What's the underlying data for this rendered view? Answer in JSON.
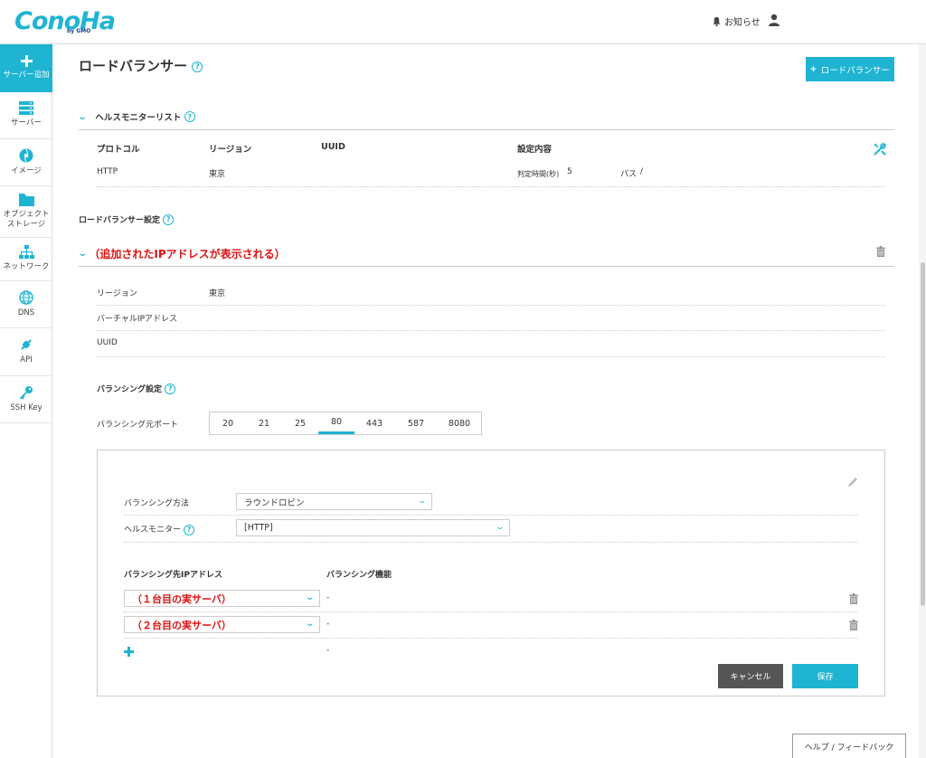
{
  "header": {
    "logo": "ConoHa",
    "logo_sub": "by GMO",
    "notice_label": "お知らせ"
  },
  "sidebar": {
    "items": [
      {
        "label": "サーバー追加",
        "icon": "plus-icon"
      },
      {
        "label": "サーバー",
        "icon": "server-icon"
      },
      {
        "label": "イメージ",
        "icon": "image-icon"
      },
      {
        "label": "オブジェクト\nストレージ",
        "icon": "folder-icon"
      },
      {
        "label": "ネットワーク",
        "icon": "network-icon"
      },
      {
        "label": "DNS",
        "icon": "globe-icon"
      },
      {
        "label": "API",
        "icon": "api-icon"
      },
      {
        "label": "SSH Key",
        "icon": "key-icon"
      }
    ]
  },
  "page": {
    "title": "ロードバランサー",
    "add_button": "ロードバランサー"
  },
  "health_monitor_list": {
    "title": "ヘルスモニターリスト",
    "columns": [
      "プロトコル",
      "リージョン",
      "UUID",
      "設定内容"
    ],
    "row": {
      "protocol": "HTTP",
      "region": "東京",
      "uuid": "",
      "judge_label": "判定時間(秒)",
      "judge_value": "5",
      "path_label": "パス",
      "path_value": "/"
    }
  },
  "lb_settings": {
    "title": "ロードバランサー設定",
    "ip_heading": "（追加されたIPアドレスが表示される）",
    "region_label": "リージョン",
    "region_value": "東京",
    "vip_label": "バーチャルIPアドレス",
    "uuid_label": "UUID"
  },
  "balancing": {
    "title": "バランシング設定",
    "port_label": "バランシング元ポート",
    "ports": [
      "20",
      "21",
      "25",
      "80",
      "443",
      "587",
      "8080"
    ],
    "active_port": "80",
    "method_label": "バランシング方法",
    "method_value": "ラウンドロビン",
    "monitor_label": "ヘルスモニター",
    "monitor_value": "[HTTP]",
    "dest_ip_header": "バランシング先IPアドレス",
    "feature_header": "バランシング機能",
    "servers": [
      {
        "value": "（１台目の実サーバ）",
        "feature": "-"
      },
      {
        "value": "（２台目の実サーバ）",
        "feature": "-"
      }
    ],
    "add_row_feature": "-",
    "cancel_label": "キャンセル",
    "save_label": "保存"
  },
  "footer": {
    "feedback_label": "ヘルプ / フィードバック"
  },
  "colors": {
    "accent": "#1eb4d2",
    "annotation_red": "#dd1111",
    "cancel_gray": "#555555"
  }
}
